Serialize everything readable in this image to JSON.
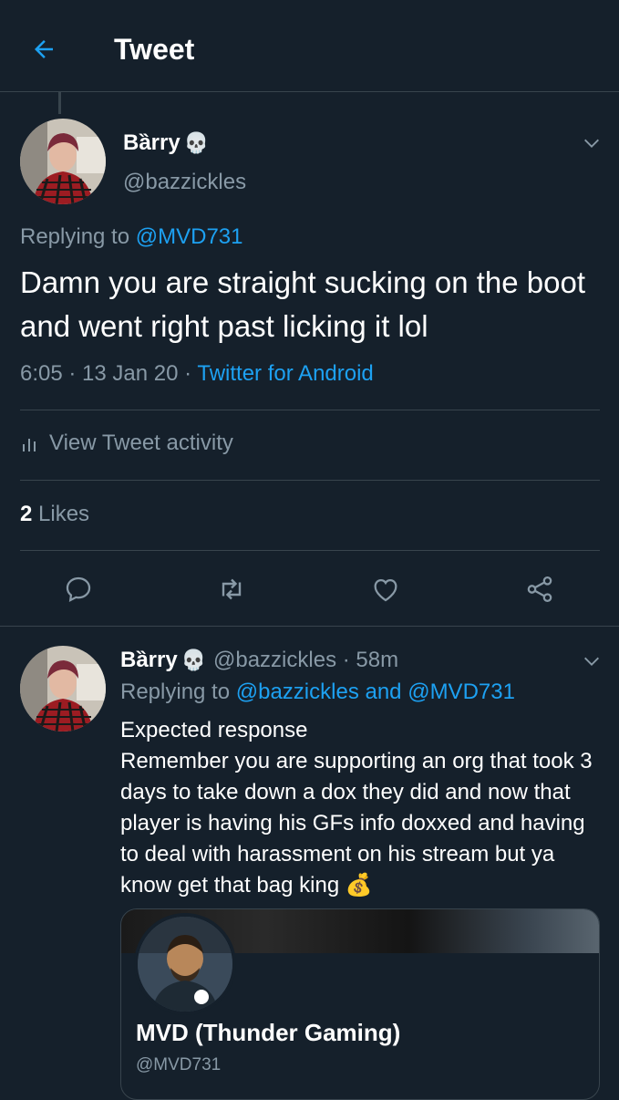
{
  "header": {
    "title": "Tweet",
    "accent": "#1da1f2",
    "back_icon": "arrow-left-icon"
  },
  "main_tweet": {
    "author_name": "Bȁrry",
    "author_emoji": "💀",
    "handle": "@bazzickles",
    "replying_label": "Replying to ",
    "replying_handle": "@MVD731",
    "text": "Damn you are straight sucking on the boot and went right past licking it lol",
    "time": "6:05 · 13 Jan 20 · ",
    "source": "Twitter for Android",
    "activity_label": "View Tweet activity",
    "likes_count": "2",
    "likes_label": " Likes",
    "actions": [
      "reply-icon",
      "retweet-icon",
      "like-icon",
      "share-icon"
    ]
  },
  "reply_tweet": {
    "author_name": "Bȁrry",
    "author_emoji": "💀",
    "handle_time": "@bazzickles · 58m",
    "replying_label": "Replying to ",
    "replying_handles": "@bazzickles and @MVD731",
    "text": "Expected response\nRemember you are supporting an org that took 3 days to take down a dox they did and now that player is having his GFs info doxxed and having to deal with harassment on his stream but ya know get that bag king 💰"
  },
  "card": {
    "name": "MVD (Thunder Gaming)",
    "handle": "@MVD731"
  },
  "colors": {
    "background": "#15202b",
    "secondary_text": "#8899a6",
    "divider": "#38444d",
    "link": "#1da1f2"
  }
}
